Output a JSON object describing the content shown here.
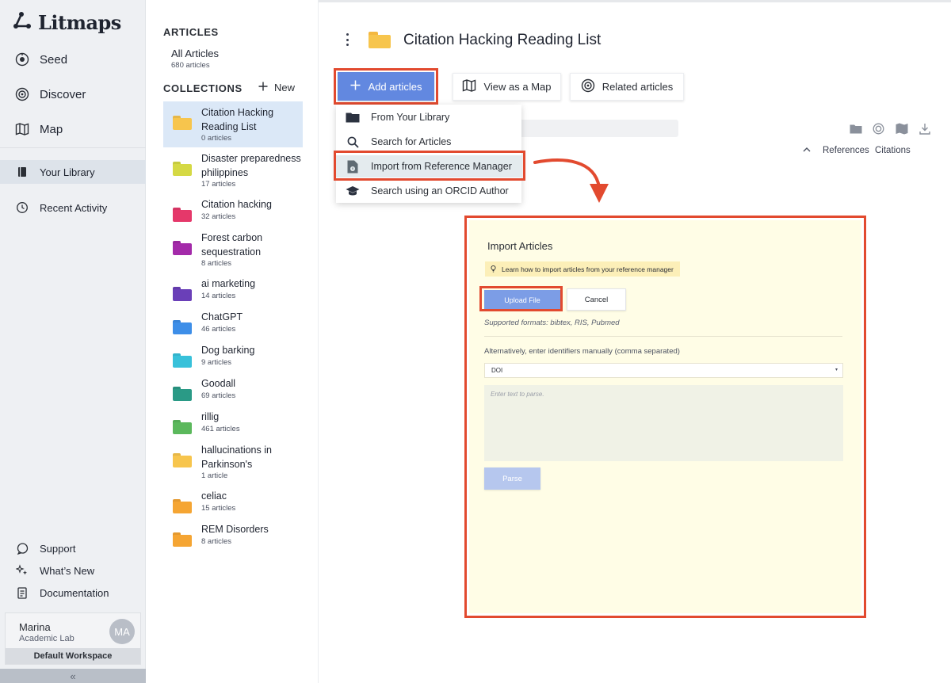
{
  "app": {
    "name": "Litmaps"
  },
  "nav": {
    "items": [
      {
        "label": "Seed",
        "icon": "seed-icon"
      },
      {
        "label": "Discover",
        "icon": "discover-icon"
      },
      {
        "label": "Map",
        "icon": "map-icon"
      },
      {
        "label": "Your Library",
        "icon": "library-icon"
      },
      {
        "label": "Recent Activity",
        "icon": "history-icon"
      }
    ],
    "footer_items": [
      {
        "label": "Support",
        "icon": "chat-icon"
      },
      {
        "label": "What’s New",
        "icon": "sparkle-icon"
      },
      {
        "label": "Documentation",
        "icon": "document-icon"
      }
    ],
    "user": {
      "name": "Marina",
      "org": "Academic Lab",
      "initials": "MA",
      "workspace": "Default Workspace"
    },
    "collapse_glyph": "«"
  },
  "library": {
    "articles_heading": "ARTICLES",
    "all_articles_label": "All Articles",
    "all_articles_count": "680 articles",
    "collections_heading": "COLLECTIONS",
    "new_label": "New",
    "collections": [
      {
        "name": "Citation Hacking Reading List",
        "count": "0 articles",
        "color": "#f7c54d",
        "selected": true
      },
      {
        "name": "Disaster preparedness philippines",
        "count": "17 articles",
        "color": "#d5d944"
      },
      {
        "name": "Citation hacking",
        "count": "32 articles",
        "color": "#e5386a"
      },
      {
        "name": "Forest carbon sequestration",
        "count": "8 articles",
        "color": "#a32aa9"
      },
      {
        "name": "ai marketing",
        "count": "14 articles",
        "color": "#6a3fb8"
      },
      {
        "name": "ChatGPT",
        "count": "46 articles",
        "color": "#3d8ee8"
      },
      {
        "name": "Dog barking",
        "count": "9 articles",
        "color": "#38c1da"
      },
      {
        "name": "Goodall",
        "count": "69 articles",
        "color": "#2a9a86"
      },
      {
        "name": "rillig",
        "count": "461 articles",
        "color": "#5bb85c"
      },
      {
        "name": "hallucinations in Parkinson's",
        "count": "1 article",
        "color": "#f7c54d"
      },
      {
        "name": "celiac",
        "count": "15 articles",
        "color": "#f5a533"
      },
      {
        "name": "REM Disorders",
        "count": "8 articles",
        "color": "#f5a533"
      }
    ]
  },
  "main": {
    "title": "Citation Hacking Reading List",
    "toolbar": {
      "add_label": "Add articles",
      "map_label": "View as a Map",
      "related_label": "Related articles"
    },
    "add_menu": [
      {
        "label": "From Your Library",
        "icon": "folder-icon"
      },
      {
        "label": "Search for Articles",
        "icon": "search-icon"
      },
      {
        "label": "Import from Reference Manager",
        "icon": "file-import-icon",
        "highlighted": true
      },
      {
        "label": "Search using an ORCID Author",
        "icon": "graduation-cap-icon"
      }
    ],
    "columns": {
      "references": "References",
      "citations": "Citations"
    }
  },
  "import_modal": {
    "title": "Import Articles",
    "tip": "Learn how to import articles from your reference manager",
    "upload_label": "Upload File",
    "cancel_label": "Cancel",
    "formats": "Supported formats: bibtex, RIS, Pubmed",
    "alt_label": "Alternatively, enter identifiers manually (comma separated)",
    "identifier_type": "DOI",
    "parse_placeholder": "Enter text to parse.",
    "parse_label": "Parse"
  },
  "colors": {
    "accent": "#6288e0",
    "highlight": "#e24a2f",
    "modal_bg": "#fffde6"
  }
}
